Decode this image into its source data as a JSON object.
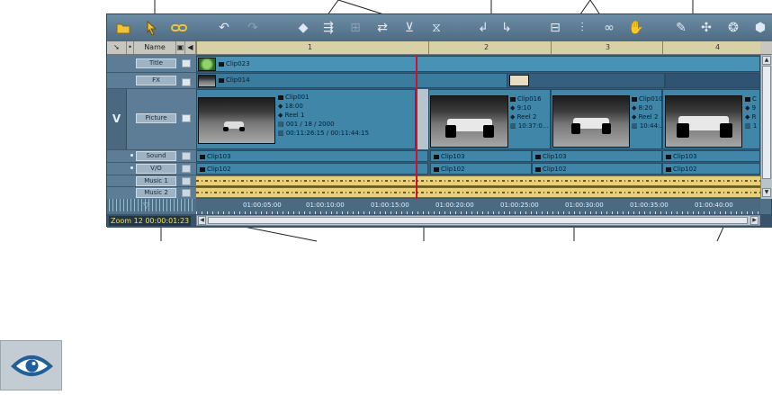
{
  "header": {
    "name_col": "Name",
    "ruler_marks": [
      "1",
      "2",
      "3",
      "4"
    ]
  },
  "tracks": [
    {
      "id": "title",
      "label": "Title"
    },
    {
      "id": "fx",
      "label": "FX"
    },
    {
      "id": "picture",
      "label": "Picture"
    },
    {
      "id": "sound",
      "label": "Sound"
    },
    {
      "id": "vo",
      "label": "V/O"
    },
    {
      "id": "music1",
      "label": "Music 1"
    },
    {
      "id": "music2",
      "label": "Music 2"
    }
  ],
  "video_group_label": "V",
  "clips": {
    "title_clip": "Clip023",
    "fx_clip": "Clip014",
    "clip001": {
      "name": "Clip001",
      "duration": "18:00",
      "reel": "Reel 1",
      "date": "001 / 18 / 2000",
      "timecode": "00:11:26:15 / 00:11:44:15"
    },
    "clip016": {
      "name": "Clip016",
      "duration": "9:10",
      "reel": "Reel 2",
      "timecode": "10:37:0..."
    },
    "clip010": {
      "name": "Clip010",
      "duration": "8:20",
      "reel": "Reel 2",
      "timecode": "10:44:..."
    },
    "clip_partial": {
      "name": "C",
      "duration": "9",
      "reel": "R",
      "timecode": "1"
    },
    "sound_clips": [
      "Clip103",
      "Clip103",
      "Clip103",
      "Clip103"
    ],
    "vo_clips": [
      "Clip102",
      "Clip102",
      "Clip102",
      "Clip102"
    ]
  },
  "timecodes": [
    "01:00:05:00",
    "01:00:10:00",
    "01:00:15:00",
    "01:00:20:00",
    "01:00:25:00",
    "01:00:30:00",
    "01:00:35:00",
    "01:00:40:00"
  ],
  "zoom": {
    "label": "Zoom 12",
    "timecode": "00:00:01:23"
  },
  "toolbar_icons": [
    "folder-icon",
    "pointer-icon",
    "link-icon",
    "undo-icon",
    "redo-icon",
    "razor-icon",
    "ripple-icon",
    "trim-icon",
    "swap-icon",
    "filter-icon",
    "split-icon",
    "insert-icon",
    "overwrite-icon",
    "fit-icon",
    "mixer-icon",
    "loop-icon",
    "hand-icon",
    "tool-a-icon",
    "tool-b-icon",
    "tool-c-icon",
    "box-icon"
  ],
  "colors": {
    "playhead": "#d2102a",
    "clip": "#3f86a8",
    "audio": "#e9cf78",
    "zoom_text": "#f2e24c"
  }
}
